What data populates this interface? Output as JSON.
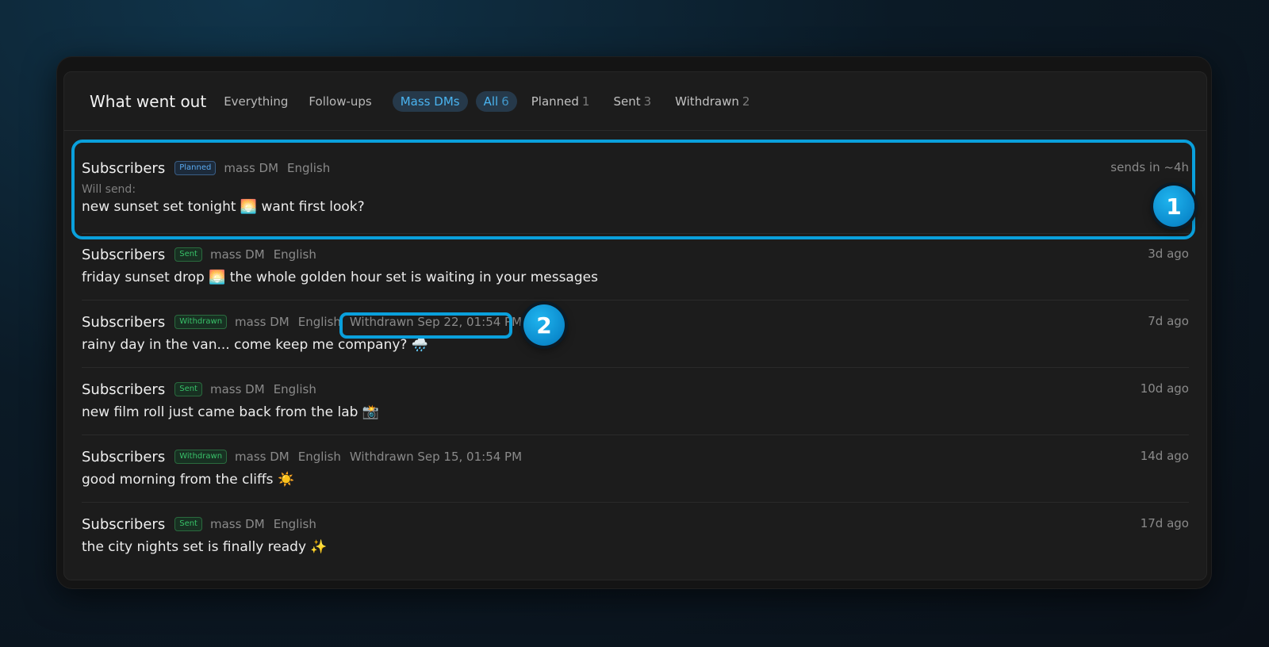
{
  "header": {
    "title": "What went out",
    "tabs": [
      {
        "label": "Everything",
        "count": ""
      },
      {
        "label": "Follow-ups",
        "count": ""
      },
      {
        "label": "Mass DMs",
        "count": ""
      },
      {
        "label": "All",
        "count": "6"
      },
      {
        "label": "Planned",
        "count": "1"
      },
      {
        "label": "Sent",
        "count": "3"
      },
      {
        "label": "Withdrawn",
        "count": "2"
      }
    ]
  },
  "rows": [
    {
      "audience": "Subscribers",
      "status": "Planned",
      "type": "mass DM",
      "lang": "English",
      "withdrawn_at": "",
      "time": "sends in ~4h",
      "prefix": "Will send:",
      "message": "new sunset set tonight 🌅 want first look?"
    },
    {
      "audience": "Subscribers",
      "status": "Sent",
      "type": "mass DM",
      "lang": "English",
      "withdrawn_at": "",
      "time": "3d ago",
      "prefix": "",
      "message": "friday sunset drop 🌅 the whole golden hour set is waiting in your messages"
    },
    {
      "audience": "Subscribers",
      "status": "Withdrawn",
      "type": "mass DM",
      "lang": "English",
      "withdrawn_at": "Withdrawn Sep 22, 01:54 PM",
      "time": "7d ago",
      "prefix": "",
      "message": "rainy day in the van... come keep me company? 🌧️"
    },
    {
      "audience": "Subscribers",
      "status": "Sent",
      "type": "mass DM",
      "lang": "English",
      "withdrawn_at": "",
      "time": "10d ago",
      "prefix": "",
      "message": "new film roll just came back from the lab 📸"
    },
    {
      "audience": "Subscribers",
      "status": "Withdrawn",
      "type": "mass DM",
      "lang": "English",
      "withdrawn_at": "Withdrawn Sep 15, 01:54 PM",
      "time": "14d ago",
      "prefix": "",
      "message": "good morning from the cliffs ☀️"
    },
    {
      "audience": "Subscribers",
      "status": "Sent",
      "type": "mass DM",
      "lang": "English",
      "withdrawn_at": "",
      "time": "17d ago",
      "prefix": "",
      "message": "the city nights set is finally ready ✨"
    }
  ],
  "callouts": [
    "1",
    "2"
  ],
  "colors": {
    "accent": "#0aa0dc",
    "planned": "#5aa9f0",
    "sent": "#38c068"
  }
}
